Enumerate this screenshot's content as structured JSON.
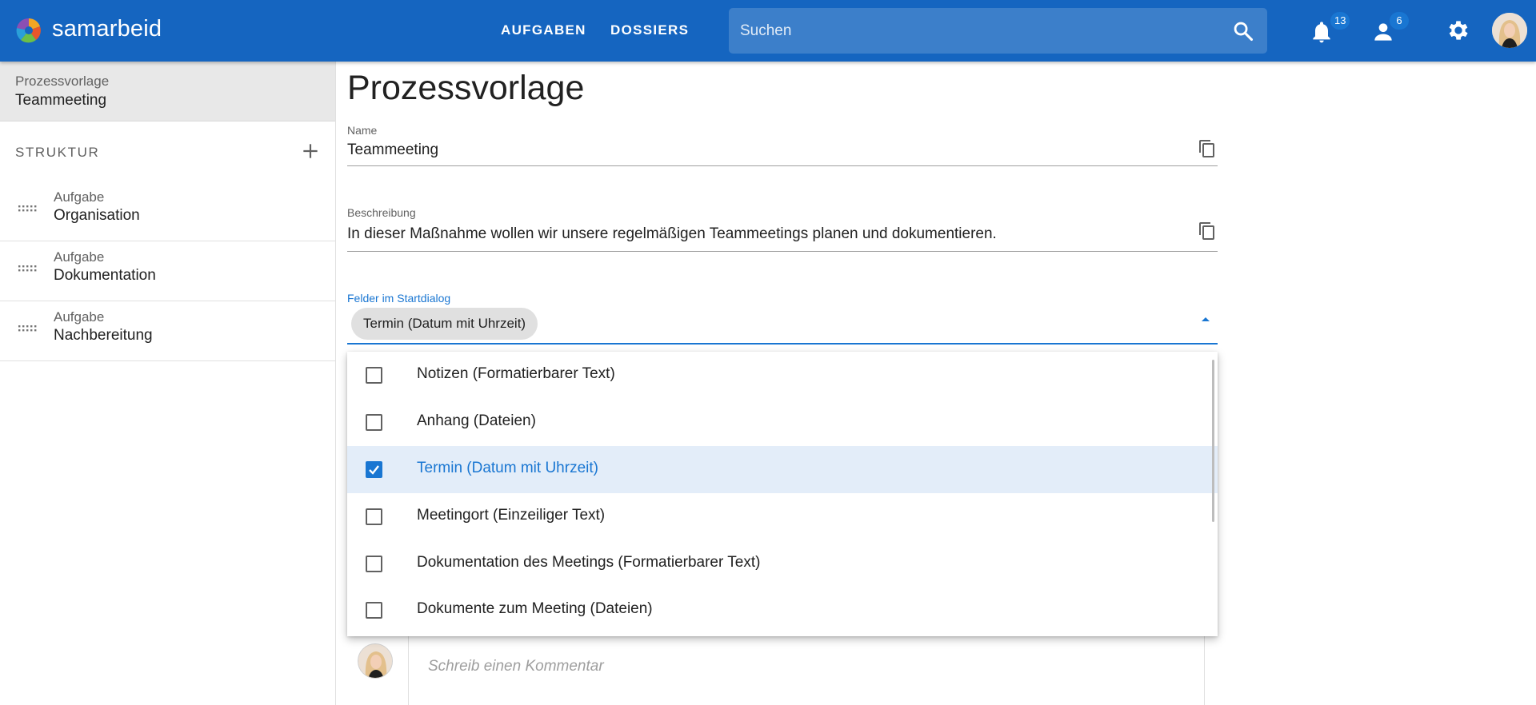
{
  "header": {
    "brand": "samarbeid",
    "nav": [
      "AUFGABEN",
      "DOSSIERS"
    ],
    "search_placeholder": "Suchen",
    "notifications_count": "13",
    "people_count": "6"
  },
  "sidebar": {
    "crumb_type": "Prozessvorlage",
    "crumb_name": "Teammeeting",
    "structure_title": "STRUKTUR",
    "tasks": [
      {
        "type": "Aufgabe",
        "name": "Organisation"
      },
      {
        "type": "Aufgabe",
        "name": "Dokumentation"
      },
      {
        "type": "Aufgabe",
        "name": "Nachbereitung"
      }
    ]
  },
  "main": {
    "title": "Prozessvorlage",
    "name_label": "Name",
    "name_value": "Teammeeting",
    "description_label": "Beschreibung",
    "description_value": "In dieser Maßnahme wollen wir unsere regelmäßigen Teammeetings planen und dokumentieren.",
    "startdialog_label": "Felder im Startdialog",
    "startdialog_chip": "Termin (Datum mit Uhrzeit)",
    "options": [
      {
        "label": "Notizen (Formatierbarer Text)",
        "checked": false
      },
      {
        "label": "Anhang (Dateien)",
        "checked": false
      },
      {
        "label": "Termin (Datum mit Uhrzeit)",
        "checked": true
      },
      {
        "label": "Meetingort (Einzeiliger Text)",
        "checked": false
      },
      {
        "label": "Dokumentation des Meetings (Formatierbarer Text)",
        "checked": false
      },
      {
        "label": "Dokumente zum Meeting (Dateien)",
        "checked": false
      }
    ],
    "comment_placeholder": "Schreib einen Kommentar"
  },
  "colors": {
    "appbar": "#1565c0",
    "accent": "#1976d2",
    "selected_row": "#e3edf9"
  }
}
